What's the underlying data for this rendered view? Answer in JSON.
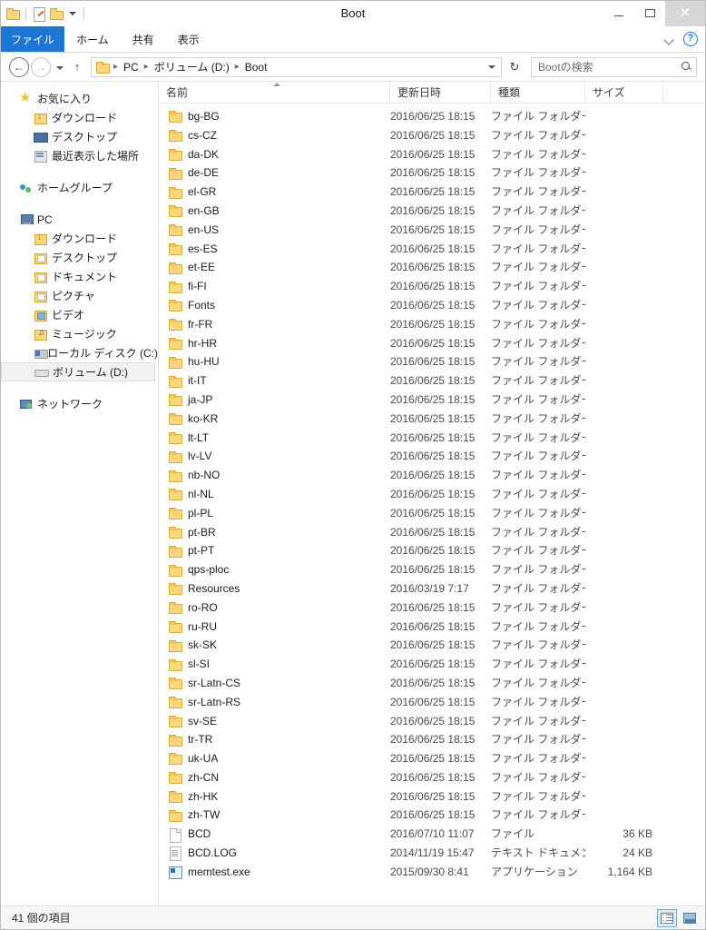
{
  "window": {
    "title": "Boot",
    "quick_access": [
      {
        "name": "folder-icon",
        "label": ""
      },
      {
        "name": "properties-icon",
        "label": ""
      },
      {
        "name": "new-folder-icon",
        "label": ""
      }
    ],
    "controls": {
      "minimize": "—",
      "maximize": "□",
      "close": "✕"
    }
  },
  "ribbon": {
    "tabs": [
      {
        "label": "ファイル",
        "active": true
      },
      {
        "label": "ホーム",
        "active": false
      },
      {
        "label": "共有",
        "active": false
      },
      {
        "label": "表示",
        "active": false
      }
    ],
    "help_label": "?"
  },
  "address": {
    "back_label": "←",
    "forward_label": "→",
    "up_label": "↑",
    "breadcrumbs": [
      "PC",
      "ボリューム (D:)",
      "Boot"
    ],
    "separator": "▸",
    "refresh_label": "↻"
  },
  "search": {
    "placeholder": "Bootの検索"
  },
  "sidebar": {
    "groups": [
      {
        "header": {
          "label": "お気に入り",
          "icon": "star-icon"
        },
        "items": [
          {
            "label": "ダウンロード",
            "icon": "downloads-icon"
          },
          {
            "label": "デスクトップ",
            "icon": "desktop-icon"
          },
          {
            "label": "最近表示した場所",
            "icon": "recent-places-icon"
          }
        ]
      },
      {
        "header": {
          "label": "ホームグループ",
          "icon": "homegroup-icon"
        },
        "items": []
      },
      {
        "header": {
          "label": "PC",
          "icon": "pc-icon"
        },
        "items": [
          {
            "label": "ダウンロード",
            "icon": "downloads-icon"
          },
          {
            "label": "デスクトップ",
            "icon": "desktop-folder-icon"
          },
          {
            "label": "ドキュメント",
            "icon": "documents-icon"
          },
          {
            "label": "ピクチャ",
            "icon": "pictures-icon"
          },
          {
            "label": "ビデオ",
            "icon": "videos-icon"
          },
          {
            "label": "ミュージック",
            "icon": "music-icon"
          },
          {
            "label": "ローカル ディスク (C:)",
            "icon": "local-disk-icon"
          },
          {
            "label": "ボリューム (D:)",
            "icon": "volume-icon",
            "selected": true
          }
        ]
      },
      {
        "header": {
          "label": "ネットワーク",
          "icon": "network-icon"
        },
        "items": []
      }
    ]
  },
  "columns": [
    {
      "key": "name",
      "label": "名前",
      "sorted": "asc"
    },
    {
      "key": "date",
      "label": "更新日時"
    },
    {
      "key": "type",
      "label": "種類"
    },
    {
      "key": "size",
      "label": "サイズ"
    }
  ],
  "files": [
    {
      "name": "bg-BG",
      "date": "2016/06/25 18:15",
      "type": "ファイル フォルダー",
      "size": "",
      "icon": "folder-icon"
    },
    {
      "name": "cs-CZ",
      "date": "2016/06/25 18:15",
      "type": "ファイル フォルダー",
      "size": "",
      "icon": "folder-icon"
    },
    {
      "name": "da-DK",
      "date": "2016/06/25 18:15",
      "type": "ファイル フォルダー",
      "size": "",
      "icon": "folder-icon"
    },
    {
      "name": "de-DE",
      "date": "2016/06/25 18:15",
      "type": "ファイル フォルダー",
      "size": "",
      "icon": "folder-icon"
    },
    {
      "name": "el-GR",
      "date": "2016/06/25 18:15",
      "type": "ファイル フォルダー",
      "size": "",
      "icon": "folder-icon"
    },
    {
      "name": "en-GB",
      "date": "2016/06/25 18:15",
      "type": "ファイル フォルダー",
      "size": "",
      "icon": "folder-icon"
    },
    {
      "name": "en-US",
      "date": "2016/06/25 18:15",
      "type": "ファイル フォルダー",
      "size": "",
      "icon": "folder-icon"
    },
    {
      "name": "es-ES",
      "date": "2016/06/25 18:15",
      "type": "ファイル フォルダー",
      "size": "",
      "icon": "folder-icon"
    },
    {
      "name": "et-EE",
      "date": "2016/06/25 18:15",
      "type": "ファイル フォルダー",
      "size": "",
      "icon": "folder-icon"
    },
    {
      "name": "fi-FI",
      "date": "2016/06/25 18:15",
      "type": "ファイル フォルダー",
      "size": "",
      "icon": "folder-icon"
    },
    {
      "name": "Fonts",
      "date": "2016/06/25 18:15",
      "type": "ファイル フォルダー",
      "size": "",
      "icon": "folder-icon"
    },
    {
      "name": "fr-FR",
      "date": "2016/06/25 18:15",
      "type": "ファイル フォルダー",
      "size": "",
      "icon": "folder-icon"
    },
    {
      "name": "hr-HR",
      "date": "2016/06/25 18:15",
      "type": "ファイル フォルダー",
      "size": "",
      "icon": "folder-icon"
    },
    {
      "name": "hu-HU",
      "date": "2016/06/25 18:15",
      "type": "ファイル フォルダー",
      "size": "",
      "icon": "folder-icon"
    },
    {
      "name": "it-IT",
      "date": "2016/06/25 18:15",
      "type": "ファイル フォルダー",
      "size": "",
      "icon": "folder-icon"
    },
    {
      "name": "ja-JP",
      "date": "2016/06/25 18:15",
      "type": "ファイル フォルダー",
      "size": "",
      "icon": "folder-icon"
    },
    {
      "name": "ko-KR",
      "date": "2016/06/25 18:15",
      "type": "ファイル フォルダー",
      "size": "",
      "icon": "folder-icon"
    },
    {
      "name": "lt-LT",
      "date": "2016/06/25 18:15",
      "type": "ファイル フォルダー",
      "size": "",
      "icon": "folder-icon"
    },
    {
      "name": "lv-LV",
      "date": "2016/06/25 18:15",
      "type": "ファイル フォルダー",
      "size": "",
      "icon": "folder-icon"
    },
    {
      "name": "nb-NO",
      "date": "2016/06/25 18:15",
      "type": "ファイル フォルダー",
      "size": "",
      "icon": "folder-icon"
    },
    {
      "name": "nl-NL",
      "date": "2016/06/25 18:15",
      "type": "ファイル フォルダー",
      "size": "",
      "icon": "folder-icon"
    },
    {
      "name": "pl-PL",
      "date": "2016/06/25 18:15",
      "type": "ファイル フォルダー",
      "size": "",
      "icon": "folder-icon"
    },
    {
      "name": "pt-BR",
      "date": "2016/06/25 18:15",
      "type": "ファイル フォルダー",
      "size": "",
      "icon": "folder-icon"
    },
    {
      "name": "pt-PT",
      "date": "2016/06/25 18:15",
      "type": "ファイル フォルダー",
      "size": "",
      "icon": "folder-icon"
    },
    {
      "name": "qps-ploc",
      "date": "2016/06/25 18:15",
      "type": "ファイル フォルダー",
      "size": "",
      "icon": "folder-icon"
    },
    {
      "name": "Resources",
      "date": "2016/03/19 7:17",
      "type": "ファイル フォルダー",
      "size": "",
      "icon": "folder-icon"
    },
    {
      "name": "ro-RO",
      "date": "2016/06/25 18:15",
      "type": "ファイル フォルダー",
      "size": "",
      "icon": "folder-icon"
    },
    {
      "name": "ru-RU",
      "date": "2016/06/25 18:15",
      "type": "ファイル フォルダー",
      "size": "",
      "icon": "folder-icon"
    },
    {
      "name": "sk-SK",
      "date": "2016/06/25 18:15",
      "type": "ファイル フォルダー",
      "size": "",
      "icon": "folder-icon"
    },
    {
      "name": "sl-SI",
      "date": "2016/06/25 18:15",
      "type": "ファイル フォルダー",
      "size": "",
      "icon": "folder-icon"
    },
    {
      "name": "sr-Latn-CS",
      "date": "2016/06/25 18:15",
      "type": "ファイル フォルダー",
      "size": "",
      "icon": "folder-icon"
    },
    {
      "name": "sr-Latn-RS",
      "date": "2016/06/25 18:15",
      "type": "ファイル フォルダー",
      "size": "",
      "icon": "folder-icon"
    },
    {
      "name": "sv-SE",
      "date": "2016/06/25 18:15",
      "type": "ファイル フォルダー",
      "size": "",
      "icon": "folder-icon"
    },
    {
      "name": "tr-TR",
      "date": "2016/06/25 18:15",
      "type": "ファイル フォルダー",
      "size": "",
      "icon": "folder-icon"
    },
    {
      "name": "uk-UA",
      "date": "2016/06/25 18:15",
      "type": "ファイル フォルダー",
      "size": "",
      "icon": "folder-icon"
    },
    {
      "name": "zh-CN",
      "date": "2016/06/25 18:15",
      "type": "ファイル フォルダー",
      "size": "",
      "icon": "folder-icon"
    },
    {
      "name": "zh-HK",
      "date": "2016/06/25 18:15",
      "type": "ファイル フォルダー",
      "size": "",
      "icon": "folder-icon"
    },
    {
      "name": "zh-TW",
      "date": "2016/06/25 18:15",
      "type": "ファイル フォルダー",
      "size": "",
      "icon": "folder-icon"
    },
    {
      "name": "BCD",
      "date": "2016/07/10 11:07",
      "type": "ファイル",
      "size": "36 KB",
      "icon": "file-icon"
    },
    {
      "name": "BCD.LOG",
      "date": "2014/11/19 15:47",
      "type": "テキスト ドキュメント",
      "size": "24 KB",
      "icon": "text-document-icon"
    },
    {
      "name": "memtest.exe",
      "date": "2015/09/30 8:41",
      "type": "アプリケーション",
      "size": "1,164 KB",
      "icon": "application-icon"
    }
  ],
  "status": {
    "item_count_label": "41 個の項目",
    "views": [
      {
        "name": "details-view",
        "active": true
      },
      {
        "name": "large-icons-view",
        "active": false
      }
    ]
  },
  "colors": {
    "accent": "#1b77d2",
    "folder": "#fcd77f",
    "selection": "#f2f2f2"
  }
}
